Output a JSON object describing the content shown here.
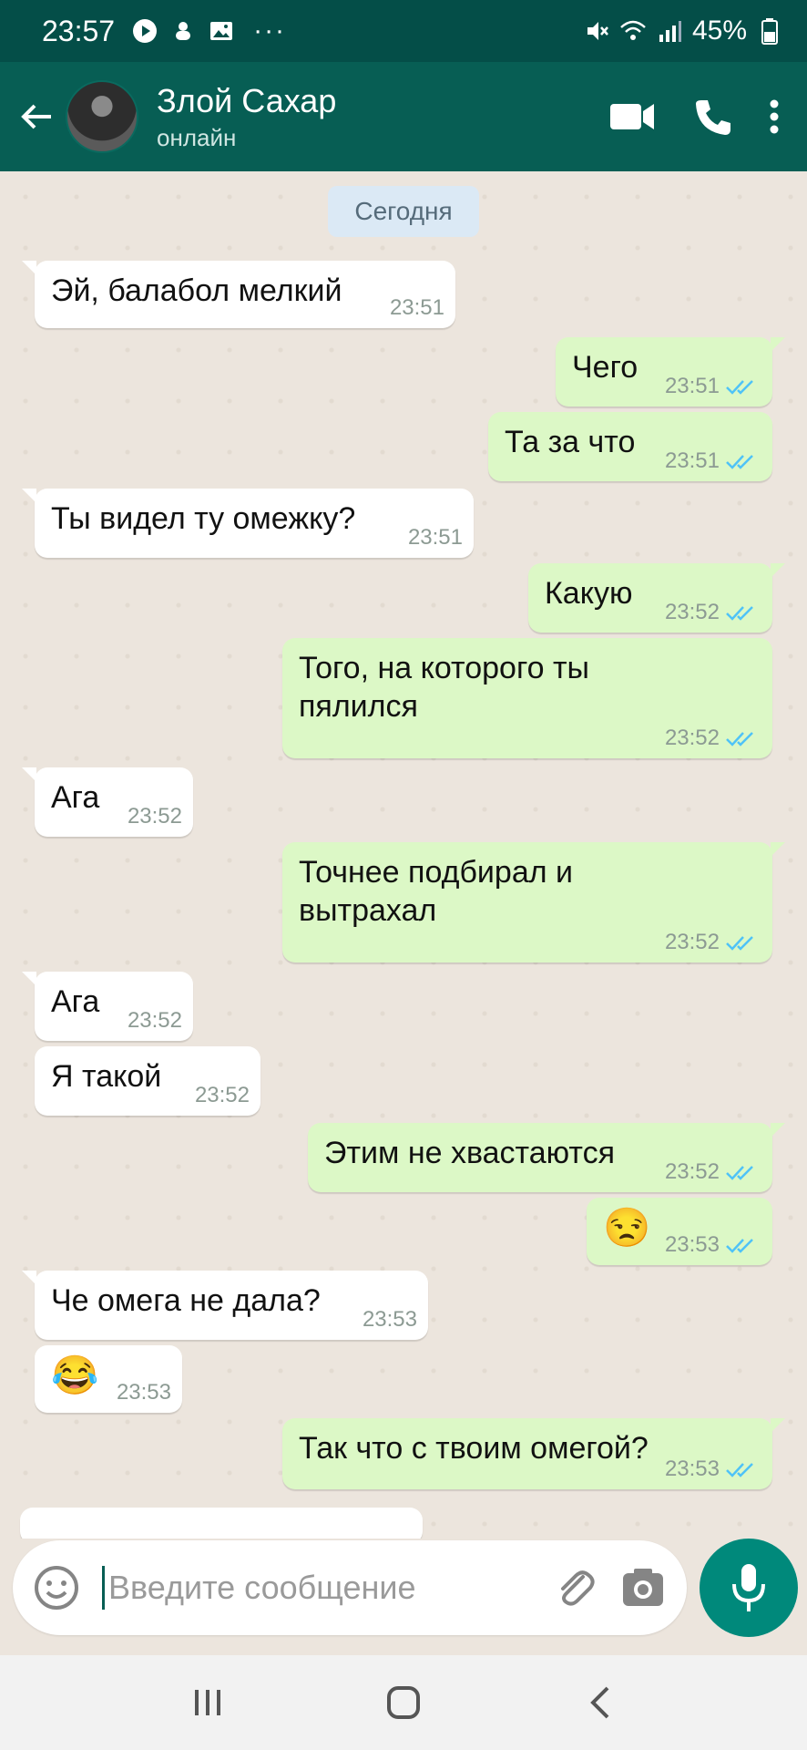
{
  "status_bar": {
    "time": "23:57",
    "battery": "45%"
  },
  "header": {
    "contact_name": "Злой Сахар",
    "contact_status": "онлайн"
  },
  "chat": {
    "date_label": "Сегодня",
    "messages": [
      {
        "dir": "in",
        "text": "Эй, балабол мелкий",
        "time": "23:51"
      },
      {
        "dir": "out",
        "text": "Чего",
        "time": "23:51"
      },
      {
        "dir": "out",
        "text": "Та за что",
        "time": "23:51"
      },
      {
        "dir": "in",
        "text": "Ты видел ту омежку?",
        "time": "23:51"
      },
      {
        "dir": "out",
        "text": "Какую",
        "time": "23:52"
      },
      {
        "dir": "out",
        "text": "Того, на которого ты\nпялился",
        "time": "23:52"
      },
      {
        "dir": "in",
        "text": "Ага",
        "time": "23:52"
      },
      {
        "dir": "out",
        "text": "Точнее подбирал и\nвытрахал",
        "time": "23:52"
      },
      {
        "dir": "in",
        "text": "Ага",
        "time": "23:52"
      },
      {
        "dir": "in",
        "text": "Я такой",
        "time": "23:52"
      },
      {
        "dir": "out",
        "text": "Этим не хвастаются",
        "time": "23:52"
      },
      {
        "dir": "out",
        "text": "😒",
        "time": "23:53"
      },
      {
        "dir": "in",
        "text": "Че омега не дала?",
        "time": "23:53"
      },
      {
        "dir": "in",
        "text": "😂",
        "time": "23:53"
      },
      {
        "dir": "out",
        "text": "Так что с твоим омегой?",
        "time": "23:53"
      }
    ]
  },
  "composer": {
    "placeholder": "Введите сообщение"
  },
  "colors": {
    "header": "#075e54",
    "status_bar": "#044e48",
    "outgoing": "#dcf8c6",
    "incoming": "#ffffff",
    "accent": "#00897b",
    "read_ticks": "#4fc3f7"
  }
}
